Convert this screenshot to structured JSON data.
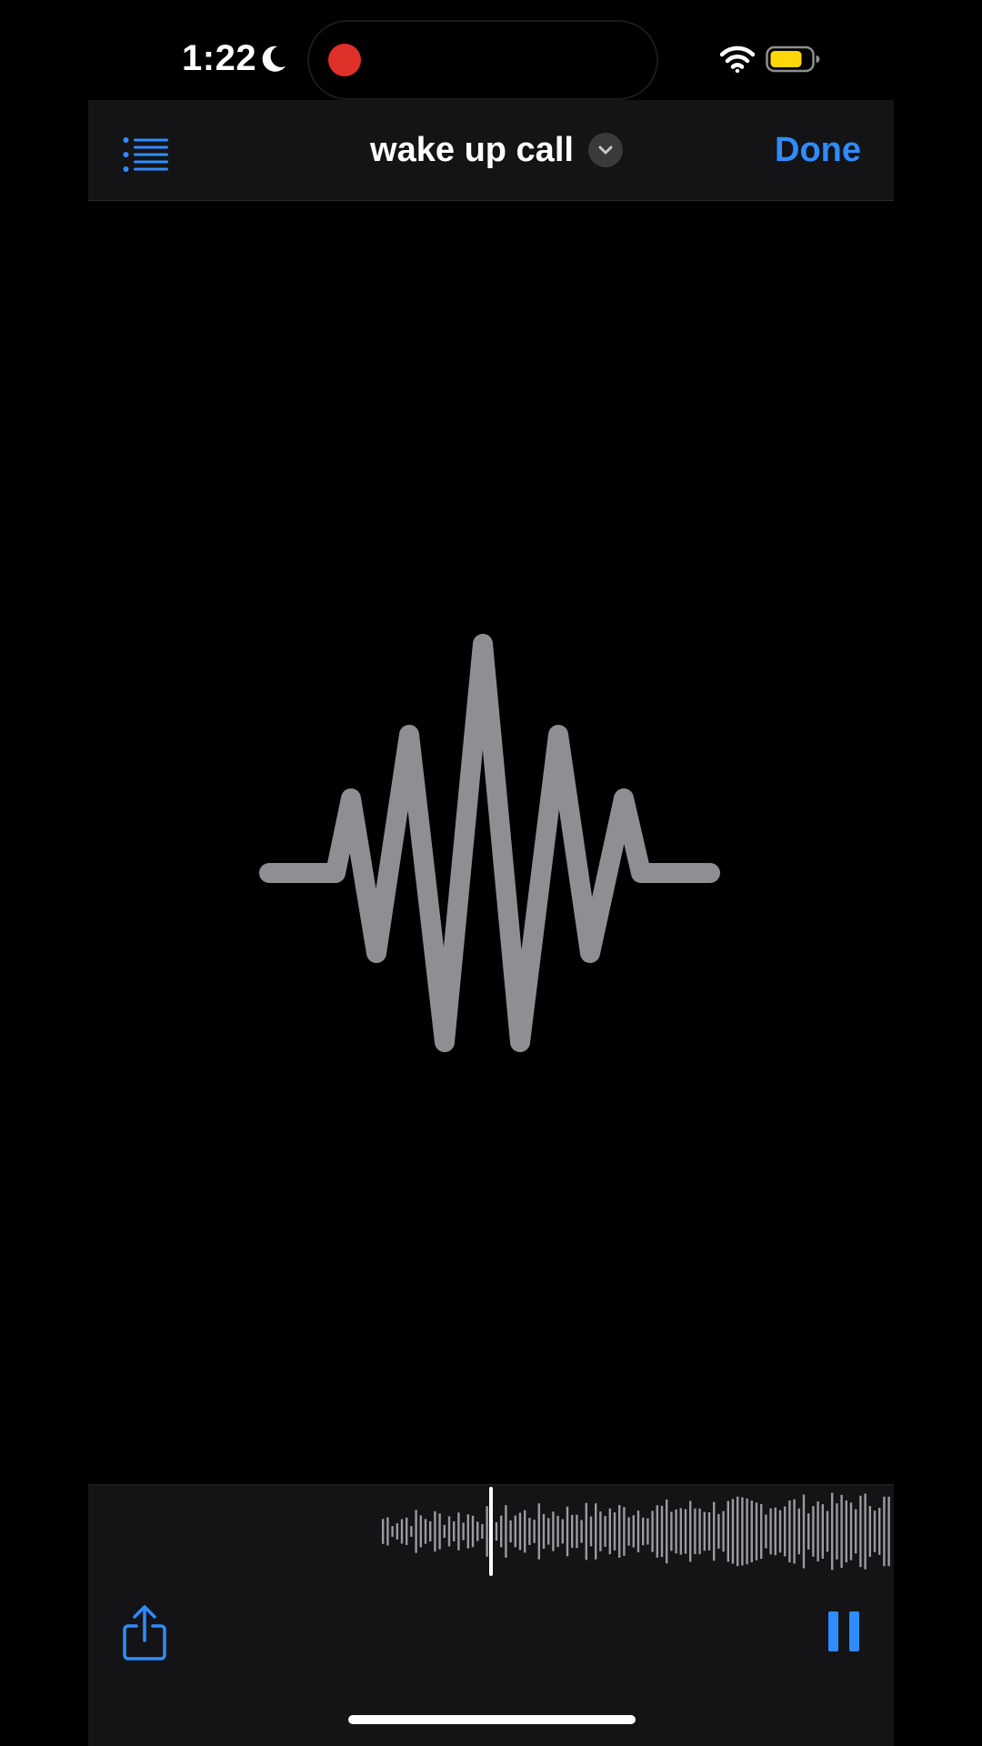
{
  "status_bar": {
    "time": "1:22",
    "focus_icon": "moon-icon",
    "recording_indicator_color": "#e0302a",
    "wifi_icon": "wifi-icon",
    "battery_icon": "battery-icon",
    "battery_color": "#ffd60a"
  },
  "nav_bar": {
    "list_icon": "list-icon",
    "title": "wake up call",
    "title_menu_icon": "chevron-down-icon",
    "done_label": "Done"
  },
  "player": {
    "waveform_icon": "waveform-icon",
    "share_icon": "share-icon",
    "pause_icon": "pause-icon"
  },
  "colors": {
    "accent": "#2f8cff",
    "background": "#000000",
    "bar_background": "#141416",
    "waveform": "#8e8e93"
  }
}
